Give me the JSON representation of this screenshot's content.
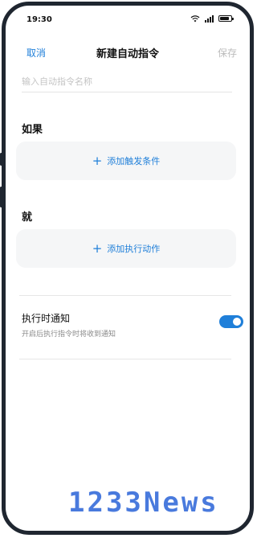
{
  "status_bar": {
    "time": "19:30",
    "wifi_icon": "wifi-icon",
    "signal_icon": "signal-icon",
    "battery_icon": "battery-icon"
  },
  "header": {
    "cancel_label": "取消",
    "title": "新建自动指令",
    "save_label": "保存"
  },
  "name_field": {
    "placeholder": "输入自动指令名称",
    "value": ""
  },
  "if_section": {
    "label": "如果",
    "add_label": "添加触发条件",
    "icon": "plus-icon"
  },
  "then_section": {
    "label": "就",
    "add_label": "添加执行动作",
    "icon": "plus-icon"
  },
  "notify": {
    "title": "执行时通知",
    "description": "开启后执行指令时将收到通知",
    "enabled": true
  },
  "watermark": "1233News",
  "colors": {
    "accent": "#1f7fd9",
    "frame": "#1f2630",
    "card_bg": "#f5f6f7",
    "disabled": "#bcbcbc"
  }
}
